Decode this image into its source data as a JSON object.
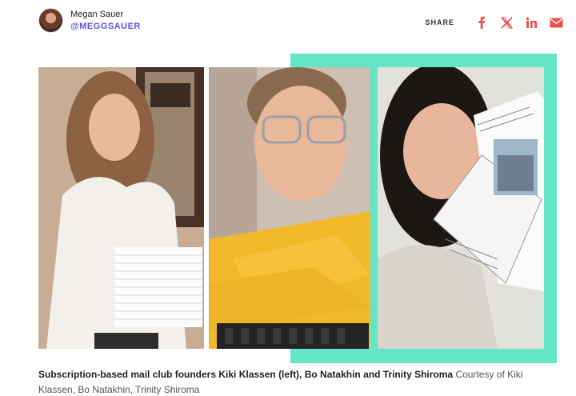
{
  "author": {
    "name": "Megan Sauer",
    "handle": "@MEGGSAUER"
  },
  "share": {
    "label": "SHARE",
    "icons": [
      "facebook-icon",
      "x-icon",
      "linkedin-icon",
      "email-icon"
    ],
    "icon_color": "#e8504d"
  },
  "colors": {
    "accent_frame": "#63e6c5",
    "handle": "#5b59e0"
  },
  "caption": {
    "main": "Subscription-based mail club founders Kiki Klassen (left), Bo Natakhin and Trinity Shiroma",
    "credit": "Courtesy of Kiki Klassen, Bo Natakhin, Trinity Shiroma"
  }
}
